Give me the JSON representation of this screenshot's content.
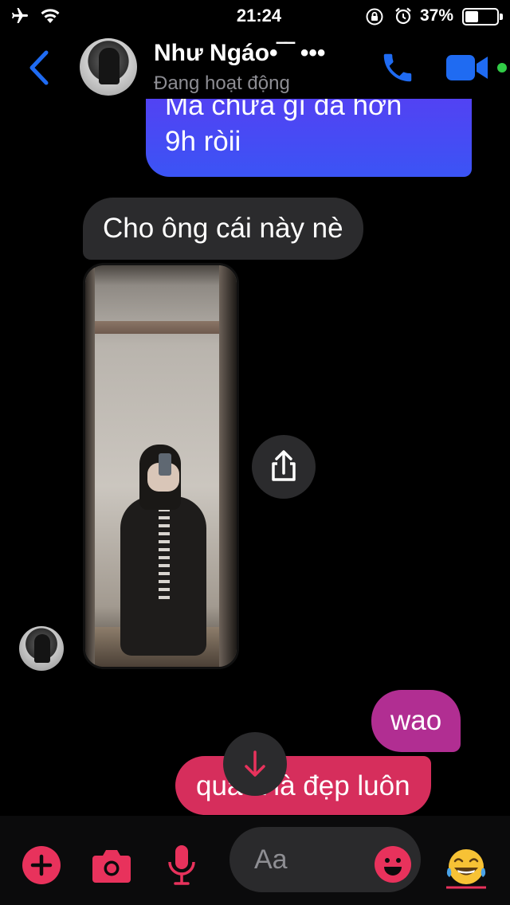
{
  "status_bar": {
    "time": "21:24",
    "battery_percent": "37%",
    "battery_level": 0.37,
    "icons": [
      "airplane-icon",
      "wifi-icon",
      "orientation-lock-icon",
      "alarm-icon",
      "battery-icon"
    ]
  },
  "header": {
    "contact_name": "Như Ngáo•‾‾ •••",
    "contact_status": "Đang hoạt động",
    "active": true,
    "icons": [
      "back-chevron-icon",
      "phone-icon",
      "video-camera-icon"
    ],
    "accent_color": "#1f6bf2"
  },
  "messages": [
    {
      "direction": "outgoing",
      "line1": "Mà chưa gì đã hơn",
      "line2": "9h ròii",
      "color": "#4a48f3"
    },
    {
      "direction": "incoming",
      "text": "Cho ông cái này nè",
      "color": "#2b2b2d"
    },
    {
      "direction": "incoming",
      "type": "photo",
      "description": "mirror-selfie"
    },
    {
      "direction": "outgoing",
      "text": "wao",
      "color": "#b12e92"
    },
    {
      "direction": "outgoing",
      "text": "quá á là đẹp luôn",
      "color": "#d62e5c"
    }
  ],
  "composer": {
    "placeholder": "Aa",
    "icons": [
      "plus-icon",
      "camera-icon",
      "microphone-icon",
      "emoji-icon",
      "laughing-tears-emoji-icon"
    ],
    "accent_color": "#e8325c",
    "reaction_emoji": "😂"
  }
}
